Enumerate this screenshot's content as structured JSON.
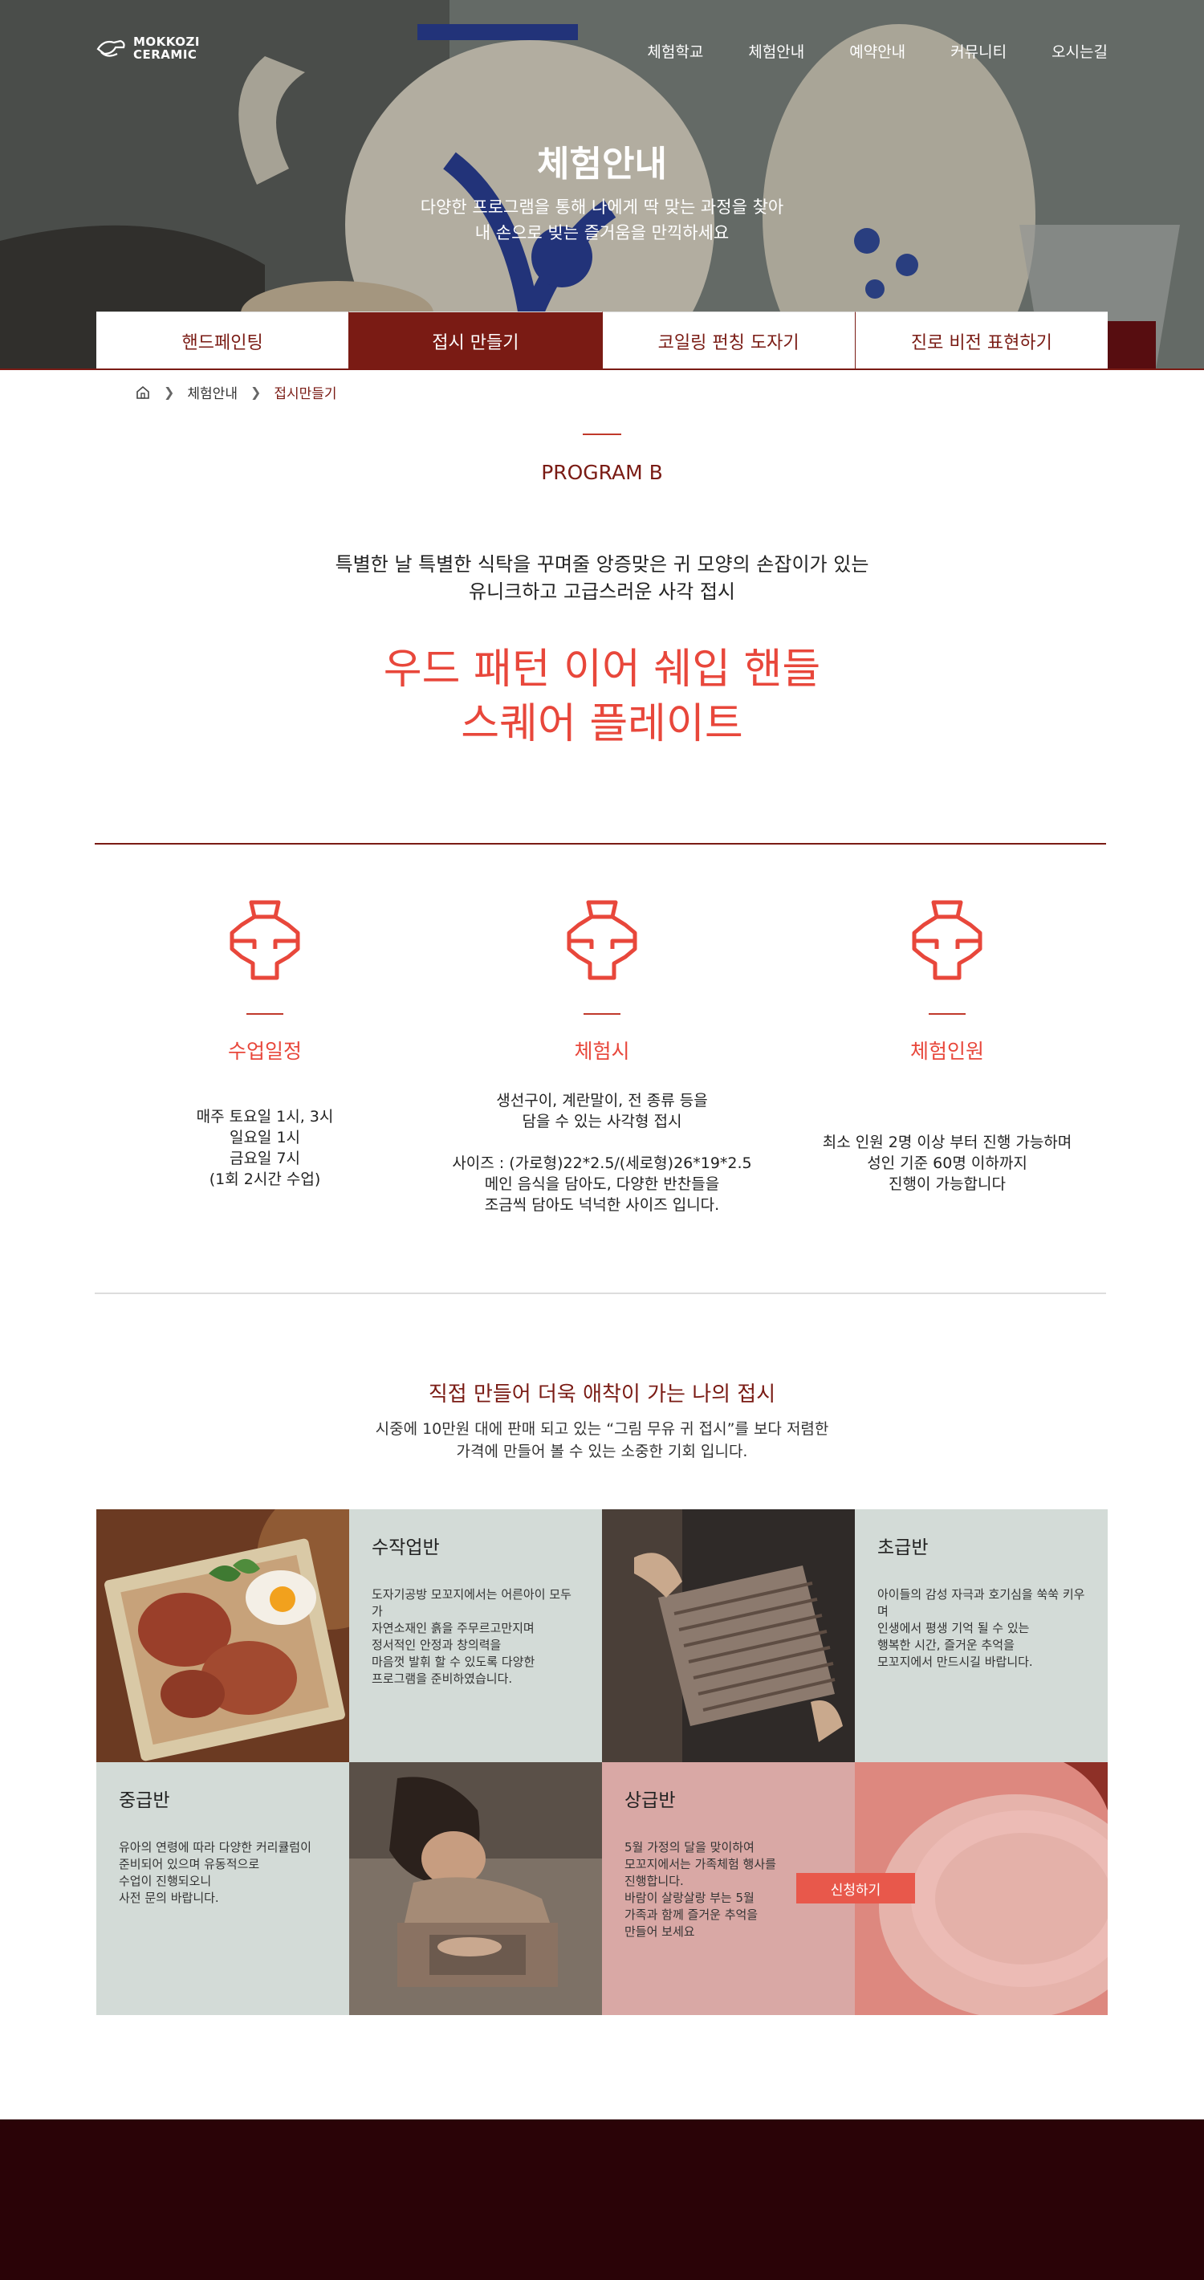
{
  "brand": {
    "line1": "MOKKOZI",
    "line2": "CERAMIC"
  },
  "nav": [
    "체험학교",
    "체험안내",
    "예약안내",
    "커뮤니티",
    "오시는길"
  ],
  "hero": {
    "title": "체험안내",
    "subtitle_line1": "다양한 프로그램을 통해 나에게 딱 맞는 과정을 찾아",
    "subtitle_line2": "내 손으로 빚는 즐거움을 만끽하세요"
  },
  "tabs": [
    "핸드페인팅",
    "접시 만들기",
    "코일링 펀칭 도자기",
    "진로 비전 표현하기"
  ],
  "active_tab": 1,
  "breadcrumb": {
    "level1": "체험안내",
    "level2": "접시만들기"
  },
  "program": {
    "label": "PROGRAM B",
    "intro_line1": "특별한 날 특별한 식탁을 꾸며줄 앙증맞은 귀  모양의 손잡이가 있는",
    "intro_line2": "유니크하고 고급스러운 사각 접시",
    "title_line1": "우드 패턴 이어  쉐입 핸들",
    "title_line2": "스퀘어 플레이트"
  },
  "features": [
    {
      "title": "수업일정",
      "icon": "vase-icon",
      "lines": [
        "매주 토요일 1시, 3시",
        "일요일 1시",
        "금요일 7시",
        "(1회 2시간  수업)"
      ]
    },
    {
      "title": "체험시",
      "icon": "vase-icon",
      "lines": [
        "생선구이, 계란말이, 전 종류 등을",
        "담을 수 있는 사각형 접시",
        "",
        "사이즈 : (가로형)22*2.5/(세로형)26*19*2.5",
        "메인 음식을 담아도, 다양한 반찬들을",
        "조금씩 담아도 넉넉한 사이즈 입니다."
      ]
    },
    {
      "title": "체험인원",
      "icon": "vase-icon",
      "lines": [
        "최소 인원 2명 이상 부터 진행 가능하며",
        "성인 기준 60명 이하까지",
        "진행이 가능합니다"
      ]
    }
  ],
  "section2": {
    "heading": "직접 만들어 더욱 애착이 가는 나의 접시",
    "desc_line1": "시중에 10만원 대에 판매 되고 있는 “그림 무유 귀 접시”를 보다 저렴한",
    "desc_line2": "가격에 만들어 볼 수 있는 소중한 기회 입니다."
  },
  "classes": {
    "handmade": {
      "title": "수작업반",
      "lines": [
        "도자기공방 모꼬지에서는 어른아이 모두가",
        "자연소재인 흙을 주무르고만지며",
        "정서적인 안정과 창의력을",
        "마음껏 발휘 할 수 있도록 다양한",
        "프로그램을 준비하였습니다."
      ]
    },
    "beginner": {
      "title": "초급반",
      "lines": [
        "아이들의 감성 자극과 호기심을 쑥쑥 키우며",
        "인생에서 평생 기억 될 수 있는",
        "행복한 시간, 즐거운 추억을",
        "모꼬지에서 만드시길 바랍니다."
      ]
    },
    "intermediate": {
      "title": "중급반",
      "lines": [
        "유아의 연령에 따라 다양한 커리큘럼이",
        "준비되어 있으며 유동적으로",
        "수업이 진행되오니",
        "사전 문의 바랍니다."
      ]
    },
    "advanced": {
      "title": "상급반",
      "lines": [
        "5월 가정의 달을 맞이하여",
        "모꼬지에서는 가족체험 행사를",
        "진행합니다.",
        "바람이 살랑살랑 부는 5월",
        "가족과 함께 즐거운 추억을",
        "만들어 보세요"
      ]
    }
  },
  "apply_button": "신청하기",
  "colors": {
    "brand_dark": "#7a1b14",
    "accent": "#e8473b",
    "mint": "#d3dbd7",
    "rose": "#d9a8a5",
    "footer": "#2a0307"
  }
}
